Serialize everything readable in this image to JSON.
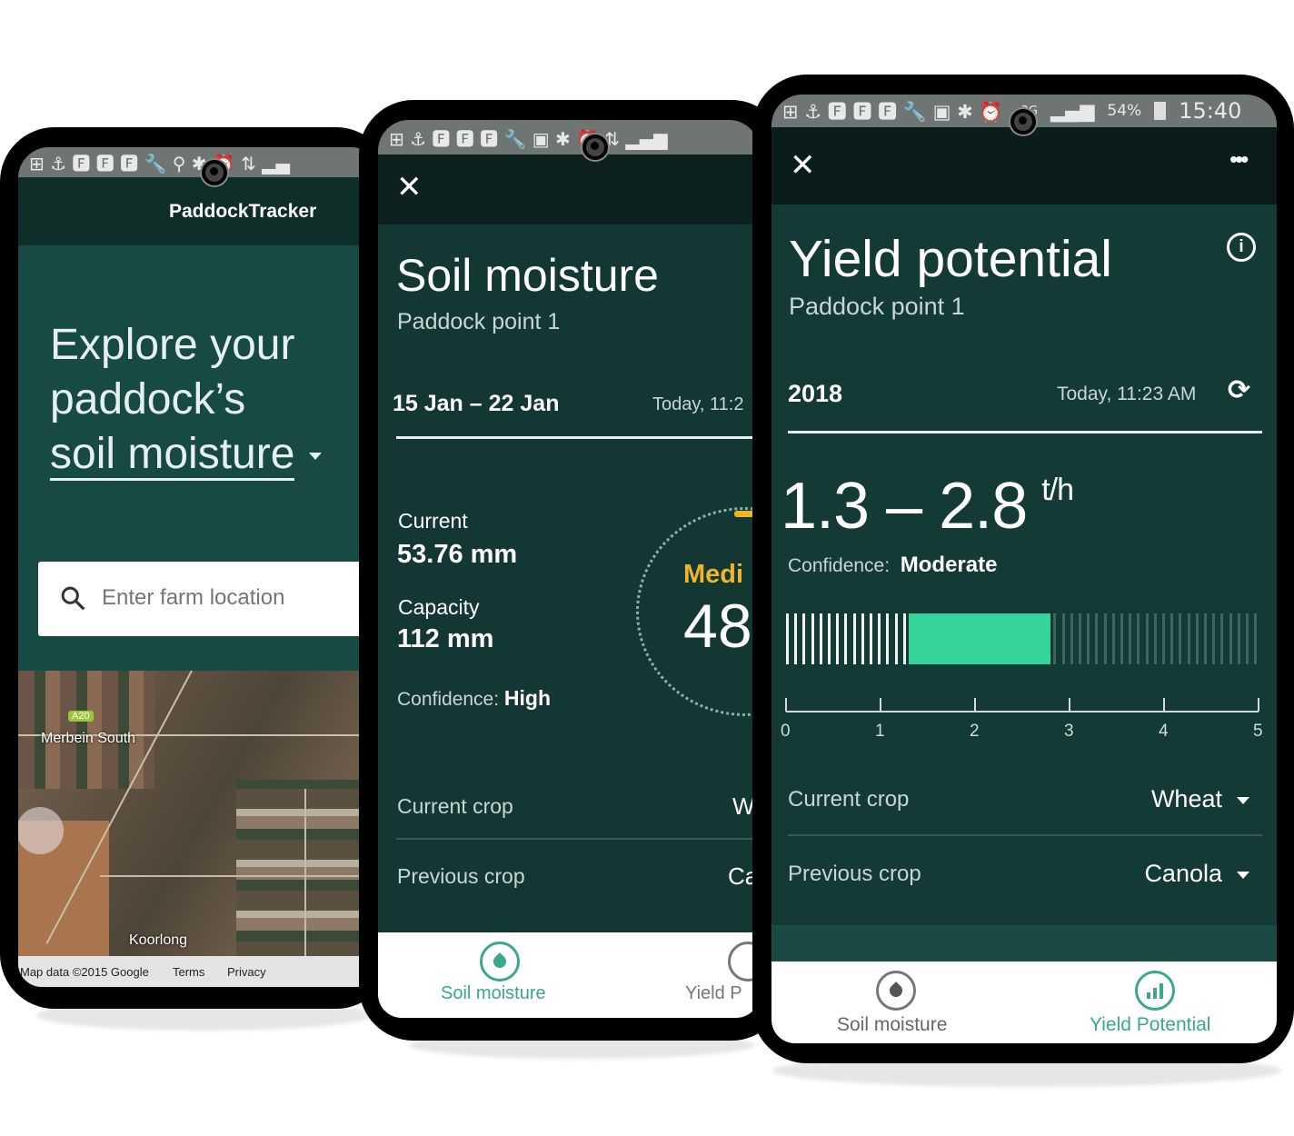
{
  "phone1": {
    "status_icons": [
      "+",
      "⚓",
      "f",
      "f",
      "f",
      "wrench",
      "pin",
      "bluetooth",
      "alarm",
      "H+",
      "signal"
    ],
    "app_title": "PaddockTracker",
    "headline_line1": "Explore your",
    "headline_line2": "paddock’s",
    "headline_select": "soil moisture",
    "search": {
      "placeholder": "Enter farm location"
    },
    "map": {
      "label_town1": "Merbein South",
      "label_town2": "Koorlong",
      "road_badge": "A20",
      "attribution": "Map data ©2015 Google",
      "terms": "Terms",
      "privacy": "Privacy"
    }
  },
  "phone2": {
    "title": "Soil moisture",
    "subtitle": "Paddock point 1",
    "date_range": "15 Jan – 22 Jan",
    "updated": "Today, 11:2",
    "current_label": "Current",
    "current_value": "53.76 mm",
    "capacity_label": "Capacity",
    "capacity_value": "112 mm",
    "confidence_label": "Confidence:",
    "confidence_value": "High",
    "gauge_level": "Medi",
    "gauge_value": "48",
    "current_crop_label": "Current crop",
    "current_crop_value": "W",
    "previous_crop_label": "Previous crop",
    "previous_crop_value": "Ca",
    "nav": [
      {
        "label": "Soil moisture",
        "active": true
      },
      {
        "label": "Yield P",
        "active": false
      }
    ]
  },
  "phone3": {
    "status": {
      "network": "3G",
      "battery": "54%",
      "time": "15:40"
    },
    "title": "Yield potential",
    "subtitle": "Paddock point 1",
    "year": "2018",
    "updated": "Today, 11:23 AM",
    "range_value": "1.3 – 2.8",
    "unit": "t/h",
    "confidence_label": "Confidence:",
    "confidence_value": "Moderate",
    "range_low": 1.3,
    "range_high": 2.8,
    "scale_ticks": [
      "0",
      "1",
      "2",
      "3",
      "4",
      "5"
    ],
    "current_crop_label": "Current crop",
    "current_crop_value": "Wheat",
    "previous_crop_label": "Previous crop",
    "previous_crop_value": "Canola",
    "nav": [
      {
        "label": "Soil moisture",
        "active": false
      },
      {
        "label": "Yield Potential",
        "active": true
      }
    ]
  },
  "colors": {
    "accent_green": "#36d39a",
    "gauge_gold": "#f0b429",
    "nav_active": "#3aa88a",
    "bg_teal": "#164a43",
    "bg_dark": "#133733"
  }
}
